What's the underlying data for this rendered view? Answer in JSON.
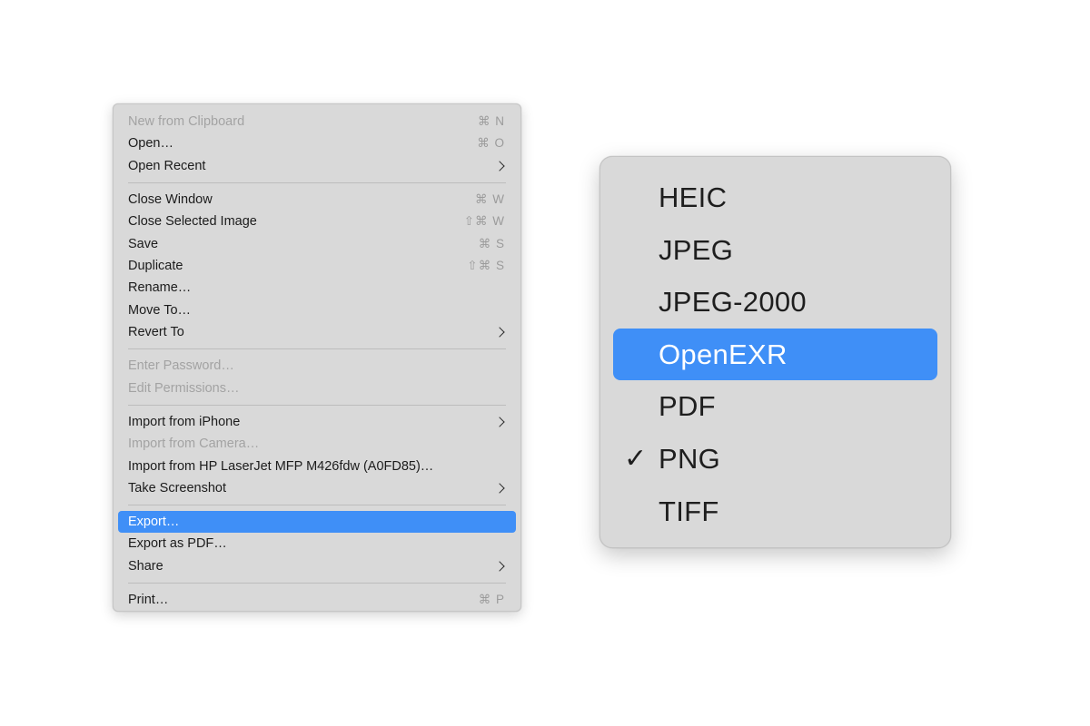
{
  "file_menu": {
    "items": [
      {
        "label": "New from Clipboard",
        "shortcut": "⌘ N"
      },
      {
        "label": "Open…",
        "shortcut": "⌘ O"
      },
      {
        "label": "Open Recent"
      },
      {
        "label": "Close Window",
        "shortcut": "⌘ W"
      },
      {
        "label": "Close Selected Image",
        "shortcut": "⇧⌘ W"
      },
      {
        "label": "Save",
        "shortcut": "⌘ S"
      },
      {
        "label": "Duplicate",
        "shortcut": "⇧⌘ S"
      },
      {
        "label": "Rename…"
      },
      {
        "label": "Move To…"
      },
      {
        "label": "Revert To"
      },
      {
        "label": "Enter Password…"
      },
      {
        "label": "Edit Permissions…"
      },
      {
        "label": "Import from iPhone"
      },
      {
        "label": "Import from Camera…"
      },
      {
        "label": "Import from HP LaserJet MFP M426fdw (A0FD85)…"
      },
      {
        "label": "Take Screenshot"
      },
      {
        "label": "Export…"
      },
      {
        "label": "Export as PDF…"
      },
      {
        "label": "Share"
      },
      {
        "label": "Print…",
        "shortcut": "⌘ P"
      }
    ],
    "disabled_items": [
      "New from Clipboard",
      "Enter Password…",
      "Edit Permissions…",
      "Import from Camera…"
    ],
    "highlighted_item": "Export…"
  },
  "format_menu": {
    "items": [
      {
        "label": "HEIC"
      },
      {
        "label": "JPEG"
      },
      {
        "label": "JPEG-2000"
      },
      {
        "label": "OpenEXR"
      },
      {
        "label": "PDF"
      },
      {
        "label": "PNG"
      },
      {
        "label": "TIFF"
      }
    ],
    "highlighted_item": "OpenEXR",
    "checked_item": "PNG",
    "check_glyph": "✓"
  },
  "icons": {
    "submenu": "chevron-right-icon",
    "checked": "checkmark-icon"
  },
  "colors": {
    "highlight": "#3f8ff7",
    "menu_bg": "#d9d9d9",
    "disabled_text": "#a3a3a3"
  }
}
